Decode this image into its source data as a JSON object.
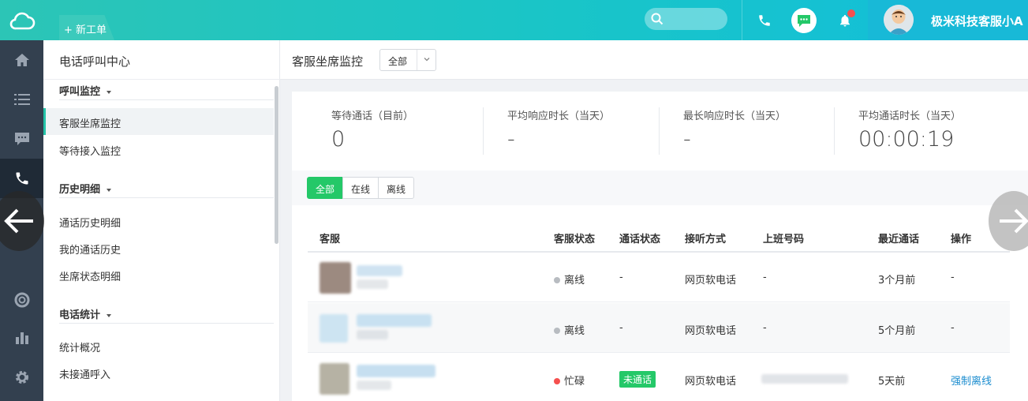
{
  "header": {
    "new_ticket_label": "+ 新工单",
    "username": "极米科技客服小A"
  },
  "sidebar": {
    "title": "电话呼叫中心",
    "groups": [
      {
        "label": "呼叫监控",
        "items": [
          "客服坐席监控",
          "等待接入监控"
        ]
      },
      {
        "label": "历史明细",
        "items": [
          "通话历史明细",
          "我的通话历史",
          "坐席状态明细"
        ]
      },
      {
        "label": "电话统计",
        "items": [
          "统计概况",
          "未接通呼入"
        ]
      }
    ],
    "active_item": "客服坐席监控"
  },
  "main": {
    "title": "客服坐席监控",
    "filter_value": "全部"
  },
  "stats": [
    {
      "label": "等待通话（目前）",
      "value": "0"
    },
    {
      "label": "平均响应时长（当天）",
      "value": "-"
    },
    {
      "label": "最长响应时长（当天）",
      "value": "-"
    },
    {
      "label": "平均通话时长（当天）",
      "value": "00:00:19"
    }
  ],
  "tabs": {
    "all": "全部",
    "online": "在线",
    "offline": "离线",
    "selected": "全部"
  },
  "table": {
    "headers": [
      "客服",
      "客服状态",
      "通话状态",
      "接听方式",
      "上班号码",
      "最近通话",
      "操作"
    ],
    "rows": [
      {
        "agent_status": "离线",
        "status_color": "#b8bcc1",
        "call_status": "-",
        "answer_method": "网页软电话",
        "work_number": "-",
        "last_call": "3个月前",
        "action": "-"
      },
      {
        "agent_status": "离线",
        "status_color": "#b8bcc1",
        "call_status": "-",
        "answer_method": "网页软电话",
        "work_number": "-",
        "last_call": "5个月前",
        "action": "-"
      },
      {
        "agent_status": "忙碌",
        "status_color": "#f5504e",
        "call_status": "未通话",
        "answer_method": "网页软电话",
        "work_number": "",
        "last_call": "5天前",
        "action": "强制离线"
      }
    ]
  },
  "colors": {
    "accent": "#24c868",
    "header_start": "#2cc5b6",
    "header_end": "#12bedb",
    "rail": "#33404f",
    "link": "#1a8ccf"
  }
}
